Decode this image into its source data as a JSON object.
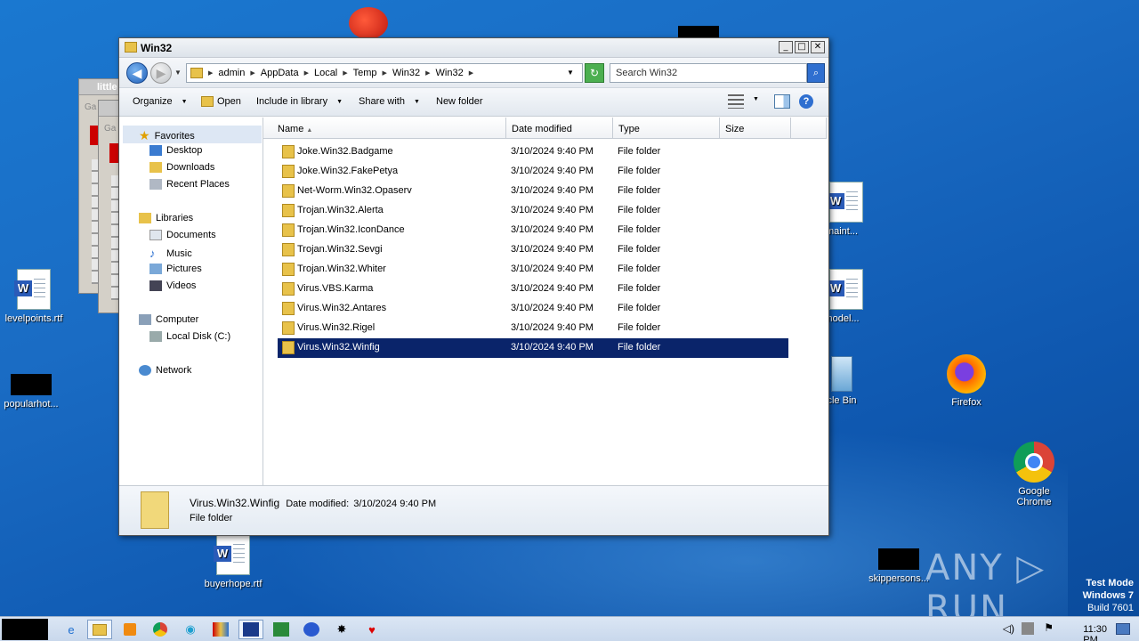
{
  "window": {
    "title": "Win32",
    "minimize": "_",
    "maximize": "□",
    "close": "✕"
  },
  "address": {
    "crumbs": [
      "admin",
      "AppData",
      "Local",
      "Temp",
      "Win32",
      "Win32"
    ],
    "search_placeholder": "Search Win32"
  },
  "toolbar": {
    "organize": "Organize",
    "open": "Open",
    "include": "Include in library",
    "share": "Share with",
    "newfolder": "New folder"
  },
  "nav": {
    "favorites": "Favorites",
    "desktop": "Desktop",
    "downloads": "Downloads",
    "recent": "Recent Places",
    "libraries": "Libraries",
    "documents": "Documents",
    "music": "Music",
    "pictures": "Pictures",
    "videos": "Videos",
    "computer": "Computer",
    "localdisk": "Local Disk (C:)",
    "network": "Network"
  },
  "columns": {
    "name": "Name",
    "date": "Date modified",
    "type": "Type",
    "size": "Size"
  },
  "files": [
    {
      "name": "Joke.Win32.Badgame",
      "date": "3/10/2024 9:40 PM",
      "type": "File folder"
    },
    {
      "name": "Joke.Win32.FakePetya",
      "date": "3/10/2024 9:40 PM",
      "type": "File folder"
    },
    {
      "name": "Net-Worm.Win32.Opaserv",
      "date": "3/10/2024 9:40 PM",
      "type": "File folder"
    },
    {
      "name": "Trojan.Win32.Alerta",
      "date": "3/10/2024 9:40 PM",
      "type": "File folder"
    },
    {
      "name": "Trojan.Win32.IconDance",
      "date": "3/10/2024 9:40 PM",
      "type": "File folder"
    },
    {
      "name": "Trojan.Win32.Sevgi",
      "date": "3/10/2024 9:40 PM",
      "type": "File folder"
    },
    {
      "name": "Trojan.Win32.Whiter",
      "date": "3/10/2024 9:40 PM",
      "type": "File folder"
    },
    {
      "name": "Virus.VBS.Karma",
      "date": "3/10/2024 9:40 PM",
      "type": "File folder"
    },
    {
      "name": "Virus.Win32.Antares",
      "date": "3/10/2024 9:40 PM",
      "type": "File folder"
    },
    {
      "name": "Virus.Win32.Rigel",
      "date": "3/10/2024 9:40 PM",
      "type": "File folder"
    },
    {
      "name": "Virus.Win32.Winfig",
      "date": "3/10/2024 9:40 PM",
      "type": "File folder"
    }
  ],
  "details": {
    "name": "Virus.Win32.Winfig",
    "date_label": "Date modified:",
    "date": "3/10/2024 9:40 PM",
    "type": "File folder"
  },
  "desktop": {
    "levelpoints": "levelpoints.rtf",
    "popularhot": "popularhot...",
    "maint": "maint...",
    "model": "model...",
    "recycle": "cle Bin",
    "firefox": "Firefox",
    "chrome_line1": "Google",
    "chrome_line2": "Chrome",
    "buyerhope": "buyerhope.rtf",
    "skippersons": "skippersons...",
    "little": "little",
    "ga": "Ga"
  },
  "taskbar": {
    "time": "11:30 PM"
  },
  "system": {
    "watermark": "ANY ▷ RUN",
    "testmode": "Test Mode",
    "os": "Windows 7",
    "build": "Build 7601"
  }
}
